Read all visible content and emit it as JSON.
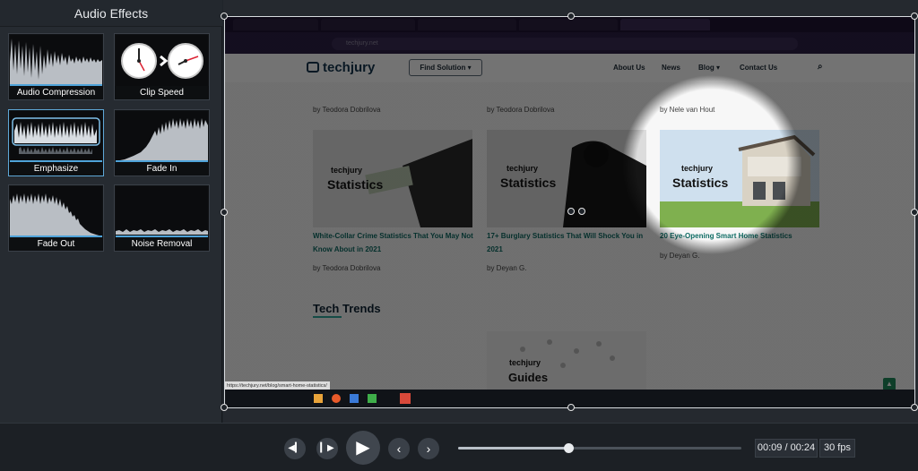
{
  "panel": {
    "title": "Audio Effects",
    "effects": [
      {
        "label": "Audio Compression"
      },
      {
        "label": "Clip Speed"
      },
      {
        "label": "Emphasize"
      },
      {
        "label": "Fade In"
      },
      {
        "label": "Fade Out"
      },
      {
        "label": "Noise Removal"
      }
    ]
  },
  "recording": {
    "url": "techjury.net",
    "brand": "techjury",
    "find_solution": "Find Solution",
    "nav": [
      "About Us",
      "News",
      "Blog",
      "Contact Us"
    ],
    "authors_top": [
      "by Teodora Dobrilova",
      "by Teodora Dobrilova",
      "by Nele van Hout"
    ],
    "card_brand": "techjury",
    "card_word": "Statistics",
    "articles": [
      {
        "title": "White-Collar Crime Statistics That You May Not Know About in 2021",
        "author": "by Teodora Dobrilova"
      },
      {
        "title": "17+ Burglary Statistics That Will Shock You in 2021",
        "author": "by Deyan G."
      },
      {
        "title": "20 Eye-Opening Smart Home Statistics",
        "author": "by Deyan G."
      }
    ],
    "section_title": "Tech Trends",
    "guides_brand": "techjury",
    "guides_word": "Guides",
    "status_link": "https://techjury.net/blog/smart-home-statistics/"
  },
  "playback": {
    "current": "00:09",
    "total": "00:24",
    "time_display": "00:09 / 00:24",
    "fps": "30 fps",
    "progress": 0.39
  },
  "colors": {
    "accent": "#5ea8d8",
    "panel_bg": "#262b31",
    "link_green": "#0d6b63"
  }
}
